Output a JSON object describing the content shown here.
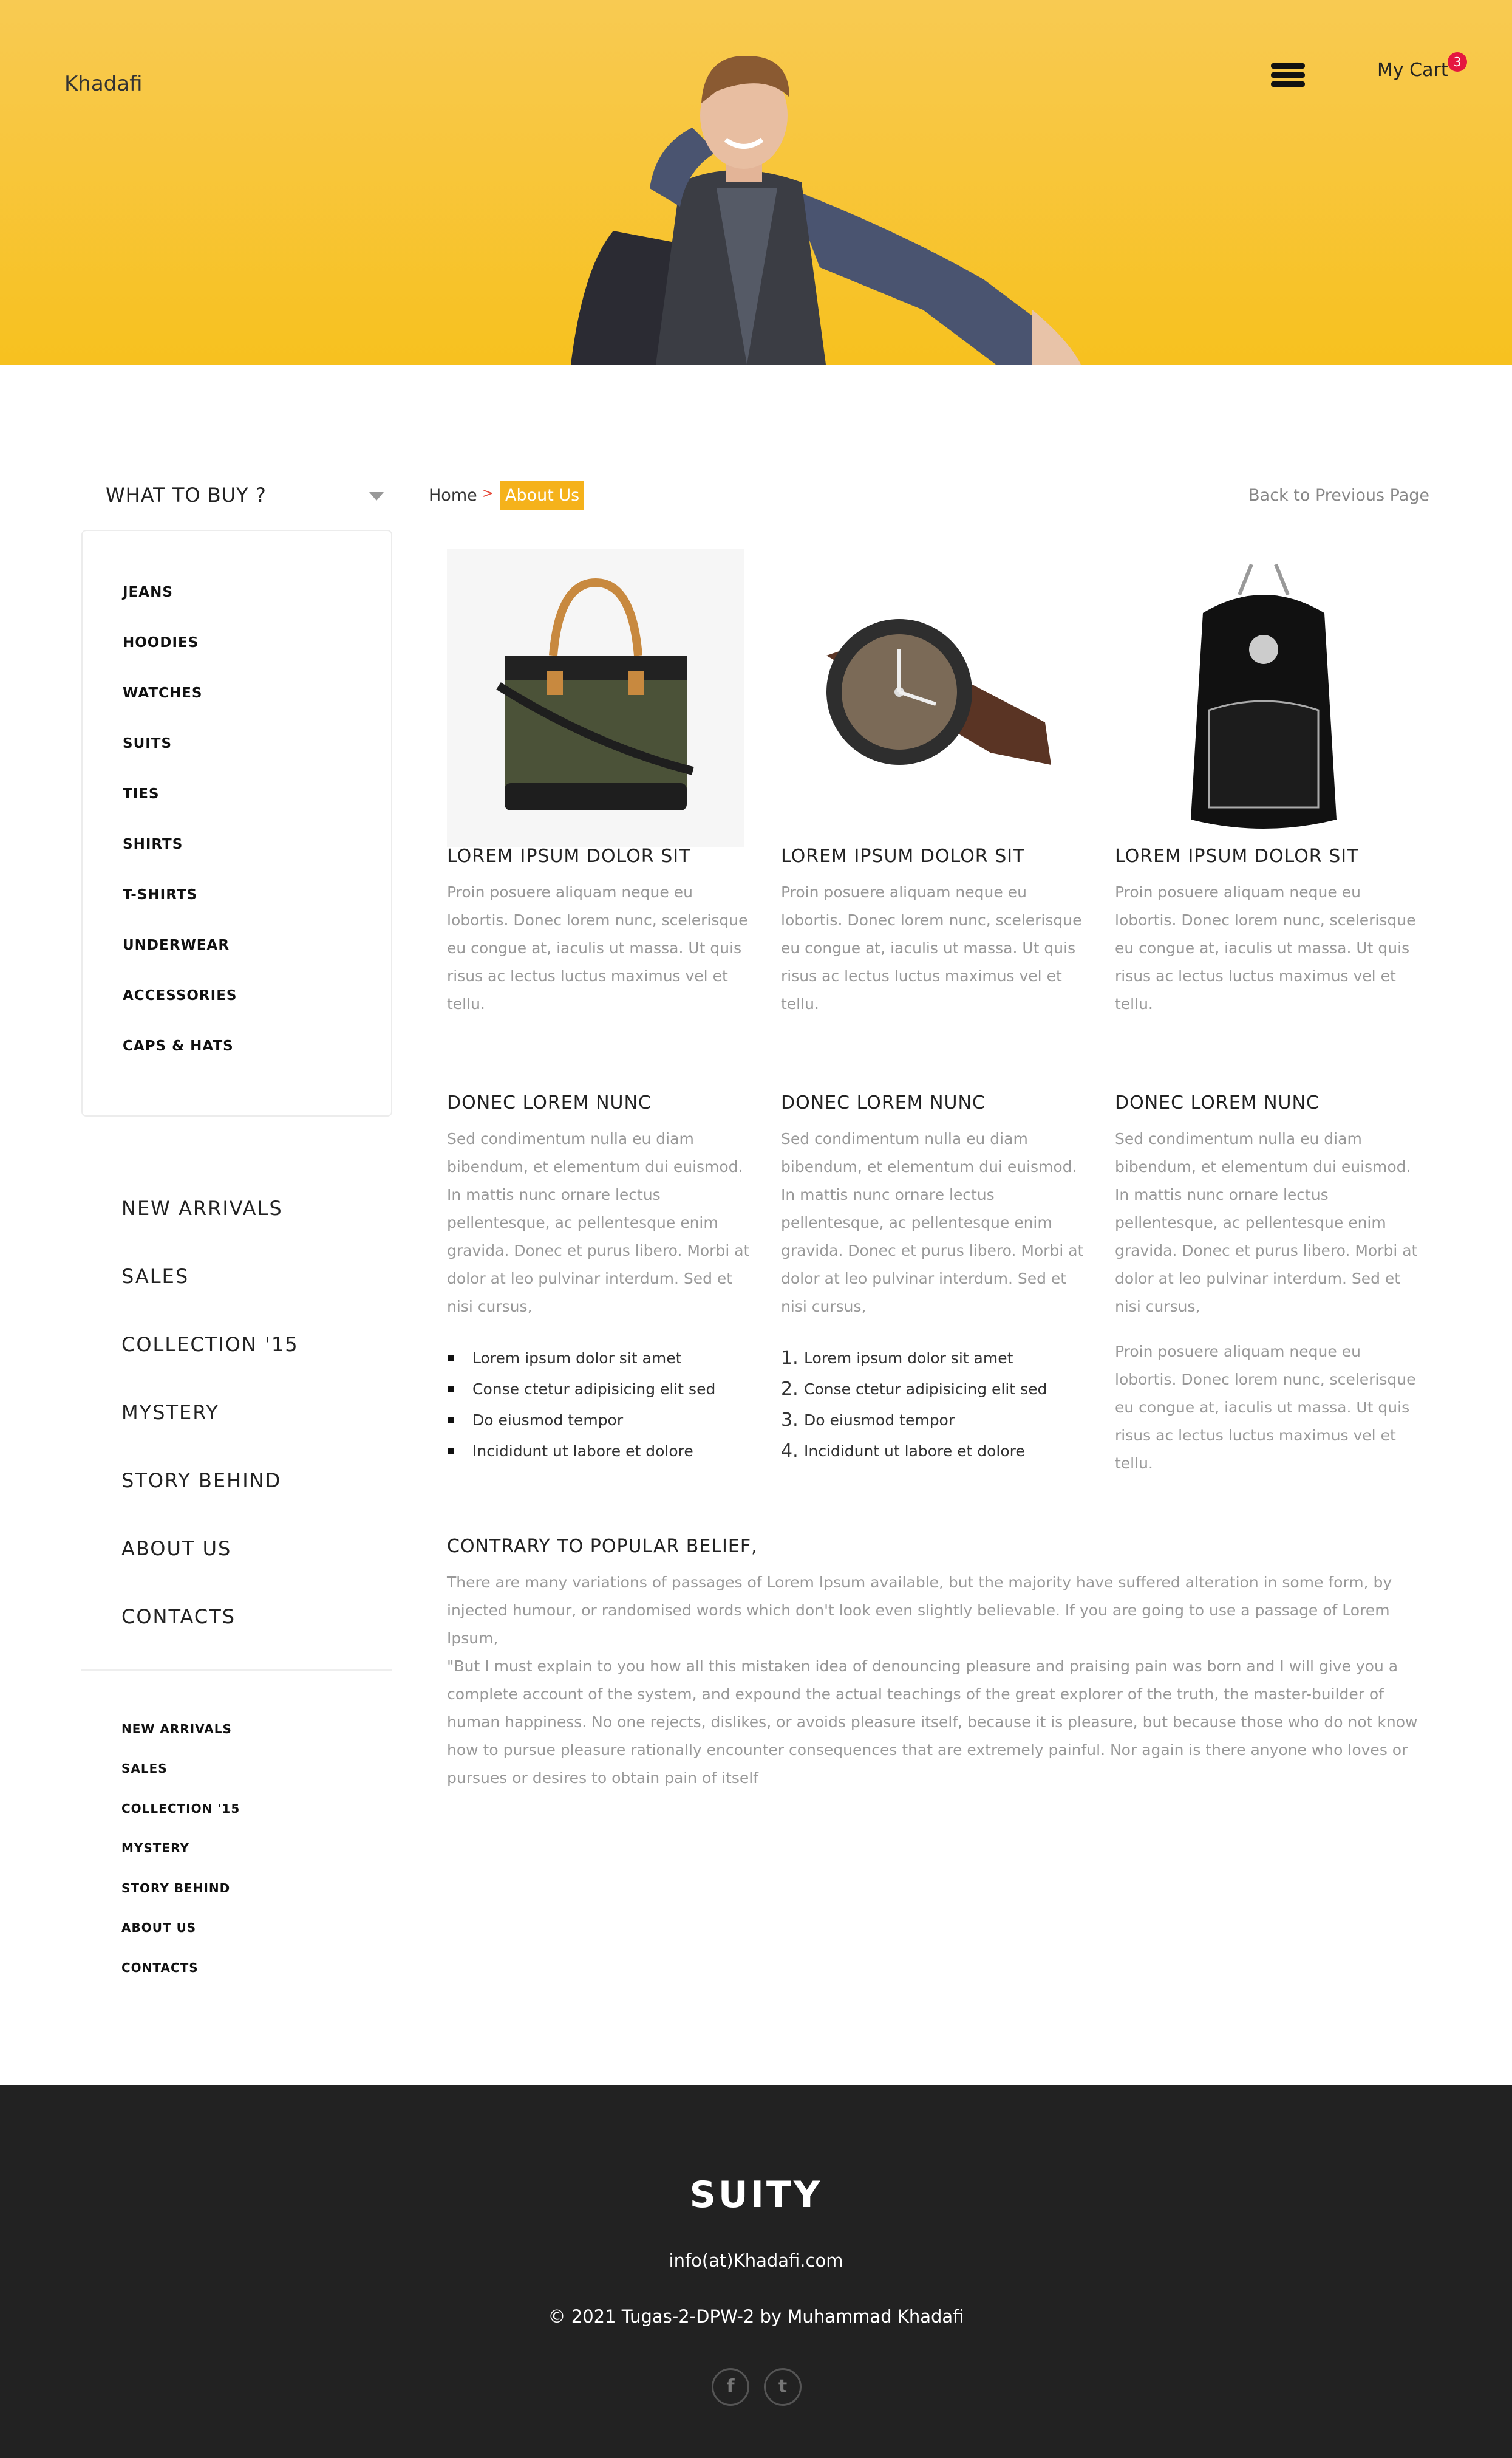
{
  "header": {
    "brand": "Khadafi",
    "cart_label": "My Cart",
    "cart_count": "3"
  },
  "sidebar": {
    "dropdown_label": "WHAT TO BUY ?",
    "categories": [
      "JEANS",
      "HOODIES",
      "WATCHES",
      "SUITS",
      "TIES",
      "SHIRTS",
      "T-SHIRTS",
      "UNDERWEAR",
      "ACCESSORIES",
      "CAPS & HATS"
    ],
    "main_nav": [
      "NEW ARRIVALS",
      "SALES",
      "COLLECTION '15",
      "MYSTERY",
      "STORY BEHIND",
      "ABOUT US",
      "CONTACTS"
    ],
    "footer_nav": [
      "NEW ARRIVALS",
      "SALES",
      "COLLECTION '15",
      "MYSTERY",
      "STORY BEHIND",
      "ABOUT US",
      "CONTACTS"
    ]
  },
  "breadcrumb": {
    "home": "Home",
    "separator": ">",
    "current": "About Us",
    "back": "Back to Previous Page"
  },
  "products": [
    {
      "image": "bag-image",
      "title": "LOREM IPSUM DOLOR SIT",
      "text": "Proin posuere aliquam neque eu lobortis. Donec lorem nunc, scelerisque eu congue at, iaculis ut massa. Ut quis risus ac lectus luctus maximus vel et tellu."
    },
    {
      "image": "watch-image",
      "title": "LOREM IPSUM DOLOR SIT",
      "text": "Proin posuere aliquam neque eu lobortis. Donec lorem nunc, scelerisque eu congue at, iaculis ut massa. Ut quis risus ac lectus luctus maximus vel et tellu."
    },
    {
      "image": "backpack-image",
      "title": "LOREM IPSUM DOLOR SIT",
      "text": "Proin posuere aliquam neque eu lobortis. Donec lorem nunc, scelerisque eu congue at, iaculis ut massa. Ut quis risus ac lectus luctus maximus vel et tellu."
    }
  ],
  "columns": [
    {
      "title": "DONEC LOREM NUNC",
      "text": "Sed condimentum nulla eu diam bibendum, et elementum dui euismod. In mattis nunc ornare lectus pellentesque, ac pellentesque enim gravida. Donec et purus libero. Morbi at dolor at leo pulvinar interdum. Sed et nisi cursus,"
    },
    {
      "title": "DONEC LOREM NUNC",
      "text": "Sed condimentum nulla eu diam bibendum, et elementum dui euismod. In mattis nunc ornare lectus pellentesque, ac pellentesque enim gravida. Donec et purus libero. Morbi at dolor at leo pulvinar interdum. Sed et nisi cursus,"
    },
    {
      "title": "DONEC LOREM NUNC",
      "text": "Sed condimentum nulla eu diam bibendum, et elementum dui euismod. In mattis nunc ornare lectus pellentesque, ac pellentesque enim gravida. Donec et purus libero. Morbi at dolor at leo pulvinar interdum. Sed et nisi cursus,",
      "extra": "Proin posuere aliquam neque eu lobortis. Donec lorem nunc, scelerisque eu congue at, iaculis ut massa. Ut quis risus ac lectus luctus maximus vel et tellu."
    }
  ],
  "bullet_list": [
    "Lorem ipsum dolor sit amet",
    "Conse ctetur adipisicing elit sed",
    "Do eiusmod tempor",
    "Incididunt ut labore et dolore"
  ],
  "numbered_list": [
    "Lorem ipsum dolor sit amet",
    "Conse ctetur adipisicing elit sed",
    "Do eiusmod tempor",
    "Incididunt ut labore et dolore"
  ],
  "numbers": [
    "1.",
    "2.",
    "3.",
    "4."
  ],
  "article": {
    "title": "CONTRARY TO POPULAR BELIEF,",
    "p1": "There are many variations of passages of Lorem Ipsum available, but the majority have suffered alteration in some form, by injected humour, or randomised words which don't look even slightly believable. If you are going to use a passage of Lorem Ipsum,",
    "p2": "\"But I must explain to you how all this mistaken idea of denouncing pleasure and praising pain was born and I will give you a complete account of the system, and expound the actual teachings of the great explorer of the truth, the master-builder of human happiness. No one rejects, dislikes, or avoids pleasure itself, because it is pleasure, but because those who do not know how to pursue pleasure rationally encounter consequences that are extremely painful. Nor again is there anyone who loves or pursues or desires to obtain pain of itself"
  },
  "footer": {
    "logo": "SUITY",
    "email": "info(at)Khadafi.com",
    "copyright": "© 2021 Tugas-2-DPW-2 by Muhammad Khadafi",
    "social": [
      "facebook-icon",
      "twitter-icon"
    ],
    "social_glyphs": [
      "f",
      "t"
    ]
  },
  "colors": {
    "hero": "#f7c11f",
    "accent": "#f5b21b",
    "badge": "#e5173f",
    "footer": "#222222"
  }
}
